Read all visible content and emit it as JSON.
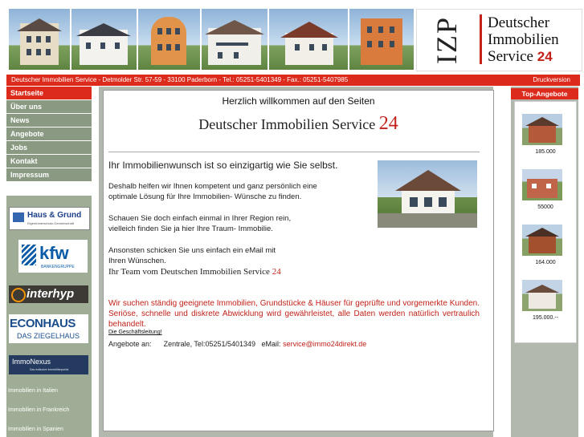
{
  "brand": {
    "logo_mark": "IZP",
    "line1": "Deutscher",
    "line2": "Immobilien",
    "line3": "Service",
    "line3_number": "24",
    "accent_color": "#dc2b1c",
    "nav_color": "#8a9a82"
  },
  "infobar": {
    "address": "Deutscher Immobilien Service - Detmolder Str. 57-59 - 33100 Paderborn - Tel.: 05251-5401349 - Fax.: 05251-5407985",
    "print": "Druckversion"
  },
  "nav": {
    "items": [
      "Startseite",
      "Über uns",
      "News",
      "Angebote",
      "Jobs",
      "Kontakt",
      "Impressum"
    ]
  },
  "partners": {
    "haus_grund": "Haus & Grund",
    "haus_grund_sub": "Eigentümerschutz-Gemeinschaft",
    "kfw": "kfw",
    "kfw_sub": "BANKENGRUPPE",
    "interhyp": "interhyp",
    "econ1": "ECONHAUS",
    "econ2": "DAS ZIEGELHAUS",
    "immonexus": "ImmoNexus",
    "immonexus_sub": "Das exklusive Immobilienportal"
  },
  "side_links": [
    "Immobilien in Italien",
    "Immobilien in Frankreich",
    "Immobilien in Spanien"
  ],
  "main": {
    "welcome": "Herzlich willkommen auf den Seiten",
    "title": "Deutscher Immobilien Service",
    "title_number": "24",
    "lead": "Ihr Immobilienwunsch ist so einzigartig wie Sie selbst.",
    "p1_line1": "Deshalb helfen wir Ihnen kompetent und ganz persönlich eine",
    "p1_line2": "optimale Lösung für Ihre Immobilien- Wünsche zu finden.",
    "p2_line1": "Schauen Sie doch einfach einmal in Ihrer Region rein,",
    "p2_line2": "vielleich finden Sie ja hier Ihre Traum- Immobilie.",
    "p3_line1": "Ansonsten schicken Sie uns einfach ein eMail mit",
    "p3_line2": "Ihren Wünschen.",
    "team": "Ihr Team vom Deutschen Immobilien Service",
    "team_number": "24",
    "red_text": "Wir suchen ständig geeignete Immobilien, Grundstücke & Häuser für geprüfte und vorgemerkte Kunden. Seriöse, schnelle und diskrete Abwicklung wird gewährleistet, alle Daten werden natürlich vertraulich behandelt.",
    "management": "Die Geschäftsleitung!",
    "offers_label": "Angebote an:",
    "offers_contact": "Zentrale, Tel:05251/5401349",
    "offers_email_label": "eMail:",
    "offers_email": "service@immo24direkt.de"
  },
  "top_offers": {
    "heading": "Top-Angebote",
    "prices": [
      "185.000",
      "55000",
      "164.000",
      "195.000.--"
    ]
  }
}
